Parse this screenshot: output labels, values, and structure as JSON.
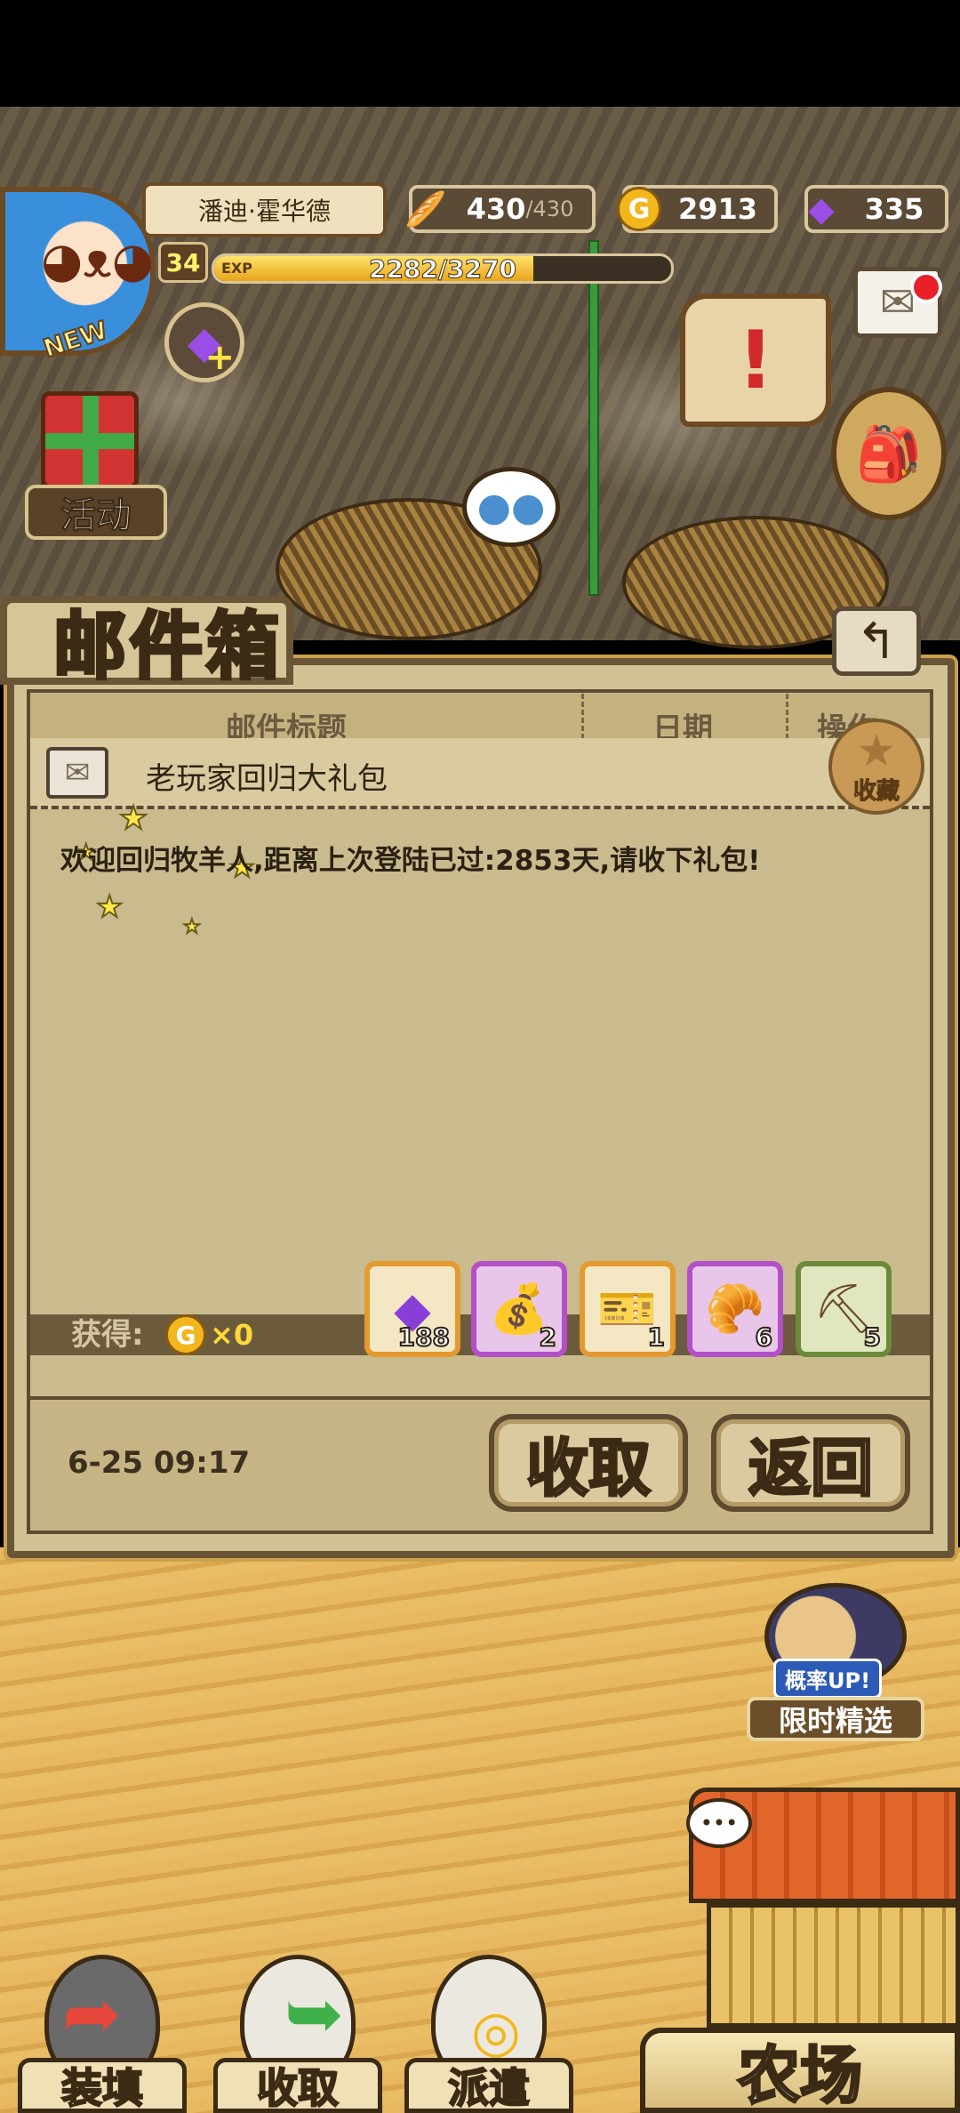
{
  "player": {
    "name": "潘迪·霍华德",
    "level": "34",
    "exp_label": "EXP",
    "exp_text": "2282/3270",
    "exp_fraction": 0.698,
    "avatar_badge": "NEW"
  },
  "resources": {
    "bread": {
      "value": "430",
      "max": "/430",
      "icon": "bread-icon"
    },
    "gold": {
      "value": "2913",
      "icon": "gold-coin-icon",
      "symbol": "G"
    },
    "gems": {
      "value": "335",
      "icon": "purple-gem-icon"
    }
  },
  "hud": {
    "event_label": "活动"
  },
  "mailbox": {
    "title": "邮件箱",
    "columns": [
      "邮件标题",
      "日期",
      "操作"
    ],
    "mail_title": "老玩家回归大礼包",
    "favorite_label": "收藏",
    "message": "欢迎回归牧羊人,距离上次登陆已过:2853天,请收下礼包!",
    "rewards_label": "获得:",
    "coin_symbol": "G",
    "coin_qty": "×0",
    "rewards": [
      {
        "icon": "purple-gem-icon",
        "qty": "188",
        "rarity": "orange"
      },
      {
        "icon": "treasure-bag-icon",
        "qty": "2",
        "rarity": "purple"
      },
      {
        "icon": "ticket-icon",
        "qty": "1",
        "rarity": "orange"
      },
      {
        "icon": "bread-basket-icon",
        "qty": "6",
        "rarity": "purple"
      },
      {
        "icon": "pickaxe-icon",
        "qty": "5",
        "rarity": "green"
      }
    ],
    "date": "6-25 09:17",
    "collect_label": "收取",
    "return_label": "返回"
  },
  "scene": {
    "limited_up": "概率UP!",
    "limited_label": "限时精选",
    "farm_label": "农场",
    "bottom_buttons": [
      "装填",
      "收取",
      "派遣"
    ]
  },
  "colors": {
    "panel": "#d2c396",
    "panel_border": "#6a5537",
    "gold": "#f2b71c",
    "gem": "#9a4ee6",
    "notification": "#e8202a"
  }
}
